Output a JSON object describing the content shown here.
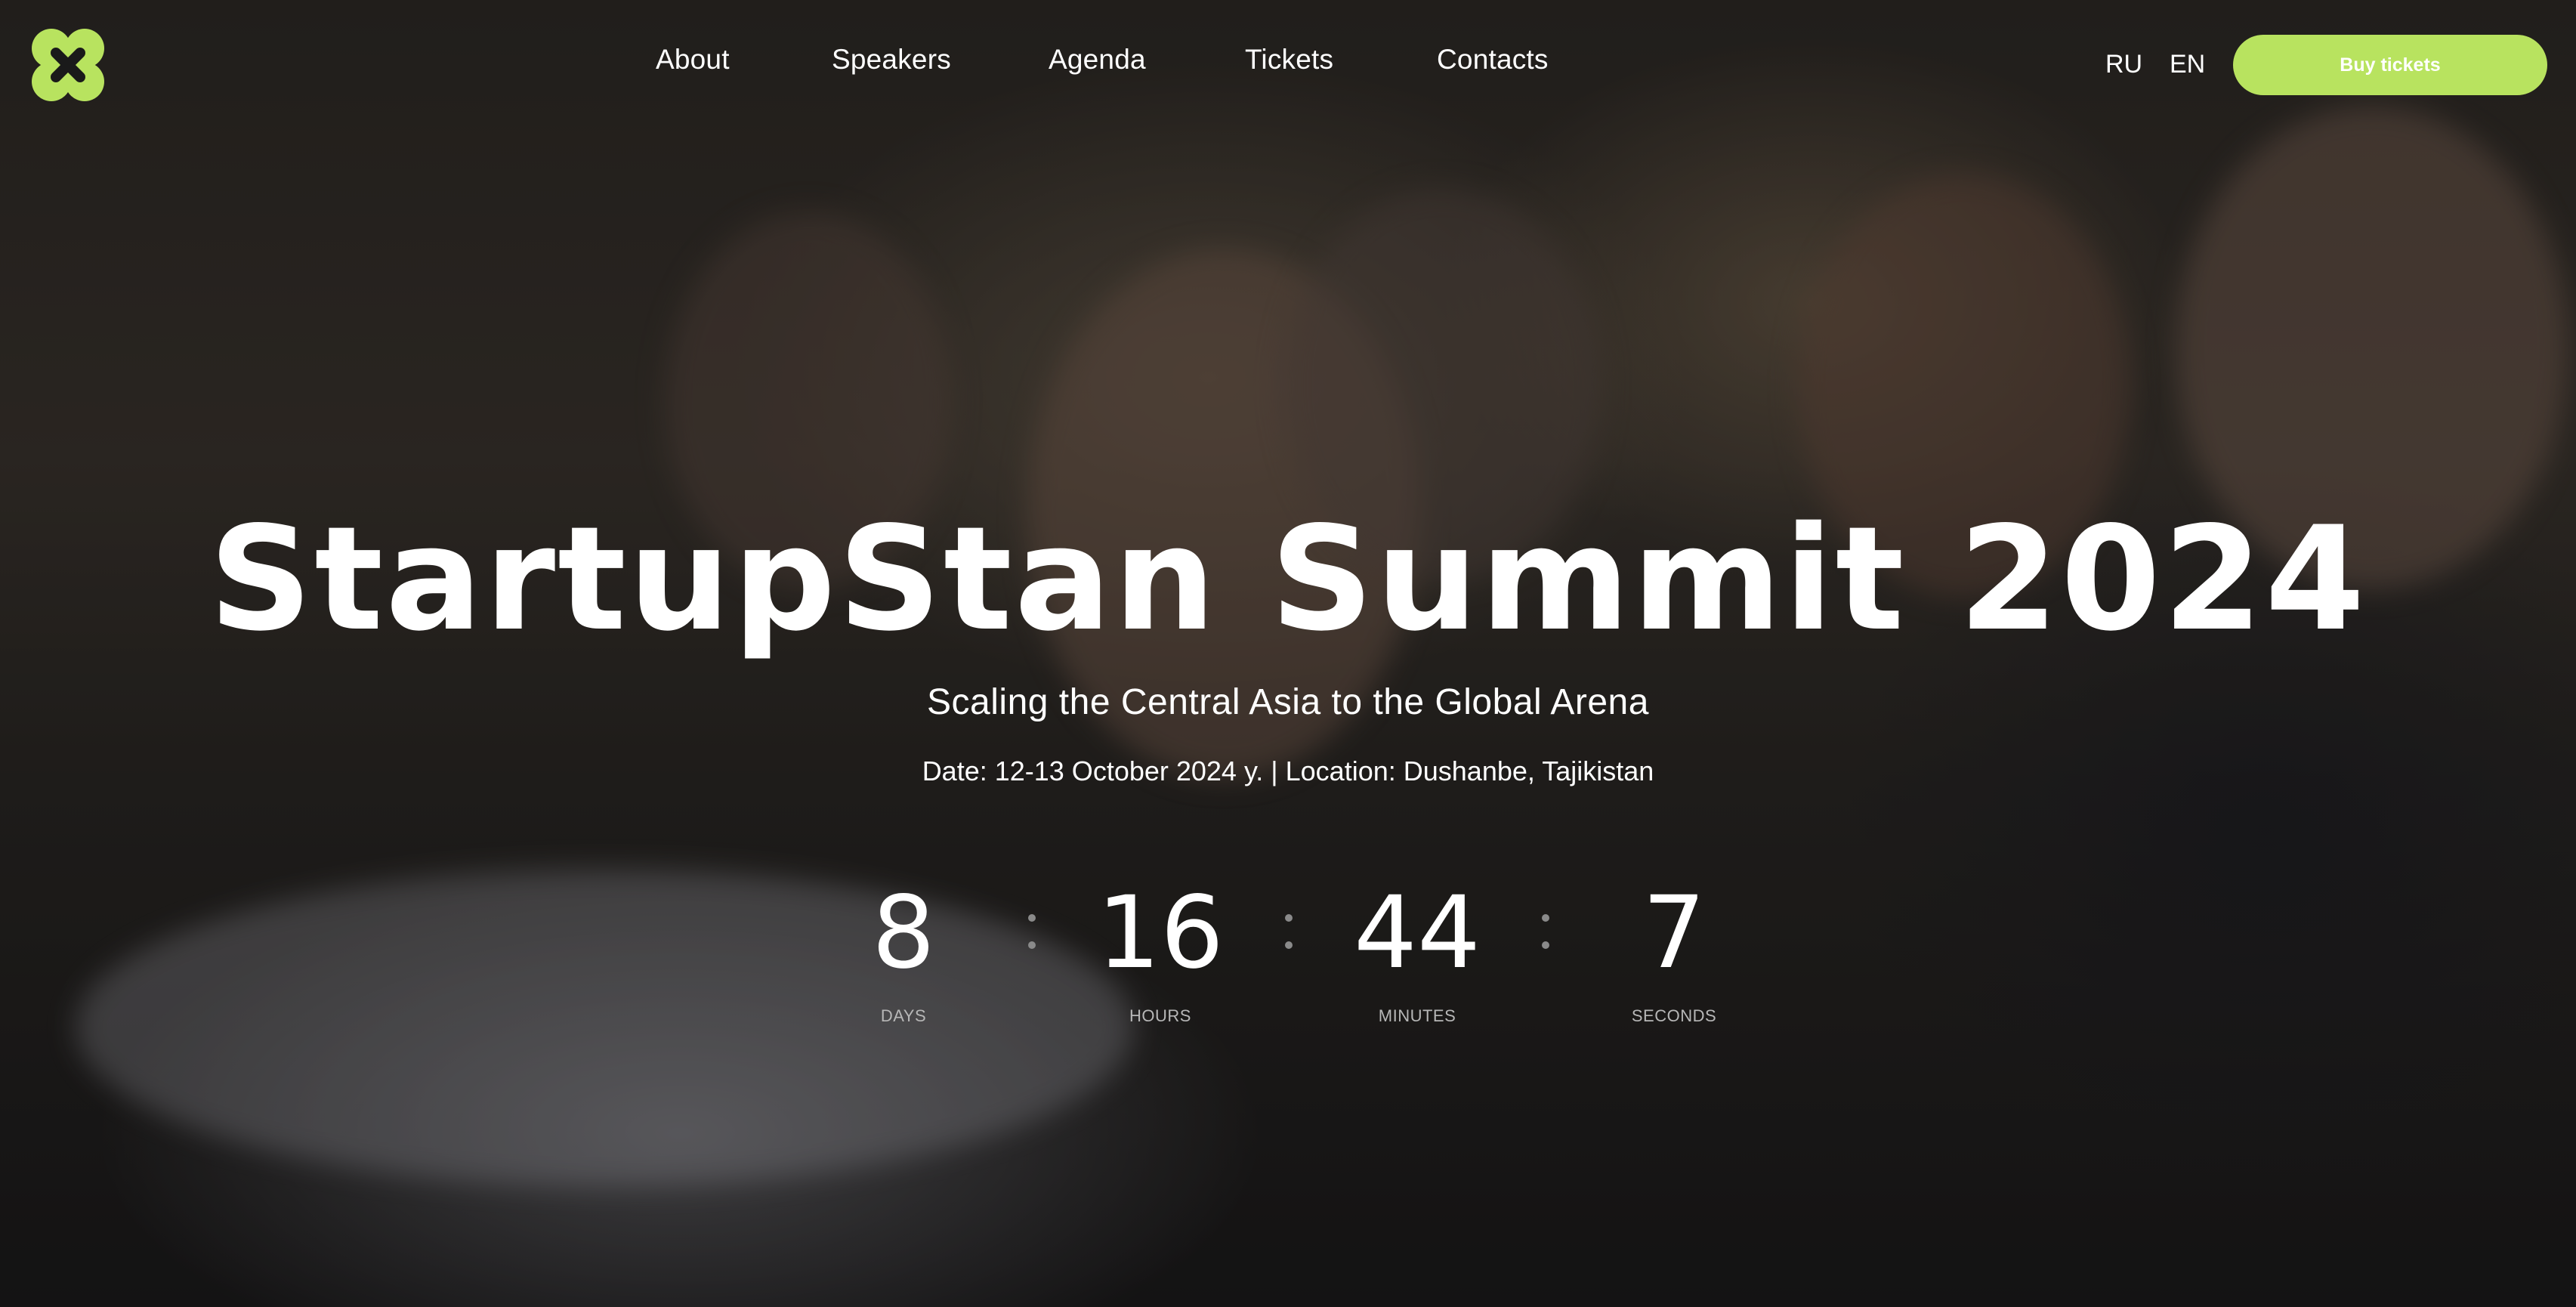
{
  "colors": {
    "accent": "#b8e35f",
    "text": "#ffffff",
    "countdown_label": "#b7b7b7"
  },
  "logo": {
    "icon": "x-blob-logo-icon"
  },
  "nav": {
    "items": [
      {
        "label": "About"
      },
      {
        "label": "Speakers"
      },
      {
        "label": "Agenda"
      },
      {
        "label": "Tickets"
      },
      {
        "label": "Contacts"
      }
    ]
  },
  "languages": {
    "ru": "RU",
    "en": "EN"
  },
  "header": {
    "buy_label": "Buy tickets"
  },
  "hero": {
    "title": "StartupStan Summit 2024",
    "subtitle": "Scaling the Central Asia to the Global Arena",
    "meta": "Date: 12-13 October 2024 y. | Location: Dushanbe, Tajikistan"
  },
  "countdown": {
    "days": {
      "value": "8",
      "label": "DAYS"
    },
    "hours": {
      "value": "16",
      "label": "HOURS"
    },
    "minutes": {
      "value": "44",
      "label": "MINUTES"
    },
    "seconds": {
      "value": "7",
      "label": "SECONDS"
    }
  }
}
